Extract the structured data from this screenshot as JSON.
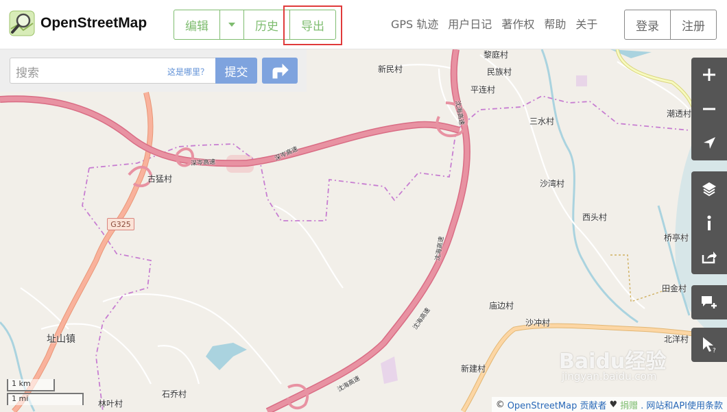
{
  "header": {
    "brand": "OpenStreetMap",
    "edit_group": {
      "edit": "编辑",
      "history": "历史",
      "export": "导出"
    },
    "secondary_nav": [
      "GPS 轨迹",
      "用户日记",
      "著作权",
      "帮助",
      "关于"
    ],
    "auth": {
      "login": "登录",
      "signup": "注册"
    }
  },
  "search": {
    "placeholder": "搜索",
    "where_am_i": "这是哪里？",
    "submit": "提交"
  },
  "map": {
    "places": {
      "liting": "黎庭村",
      "xinmin": "新民村",
      "minzu": "民族村",
      "pinglian": "平连村",
      "chaotou": "潮透村",
      "sanshui": "三水村",
      "shawan": "沙湾村",
      "gumeng": "古猛村",
      "xitou": "西头村",
      "qiaoting": "桥亭村",
      "tianjin": "田金村",
      "miaobian": "庙边村",
      "shachong": "沙冲村",
      "beiyang": "北洋村",
      "zhishan": "址山镇",
      "xinjian": "新建村",
      "linye": "林叶村",
      "shiqiao": "石乔村"
    },
    "road_shield": "G325",
    "road_names": {
      "shenling_1": "深岑高速",
      "shenling_2": "深岑高速",
      "shenhai_1": "沈海高速",
      "shenhai_2": "沈海高速",
      "shenhai_3": "沈海高速",
      "shenhai_4": "沈海高速"
    },
    "scale": {
      "km": "1 km",
      "mi": "1 mi"
    },
    "attribution": {
      "prefix": "©",
      "osm": "OpenStreetMap 贡献者",
      "heart": "♥",
      "donate": "捐赠",
      "terms": ". 网站和API使用条款"
    }
  },
  "watermark": {
    "title": "Baidu经验",
    "url": "jingyan.baidu.com"
  },
  "colors": {
    "brand_green": "#7ebc6f",
    "highlight_red": "#e03a3a",
    "search_blue": "#7ea3de",
    "map_bg": "#f2efe9",
    "motorway": "#e892a2",
    "trunk": "#f9b29c",
    "primary_orange": "#fcd6a4",
    "boundary": "#c77dd1",
    "water": "#aad3df",
    "control_grey": "#555555"
  },
  "icons": {
    "logo": "osm-logo-icon",
    "directions": "directions-icon",
    "zoom_in": "zoom-in-icon",
    "zoom_out": "zoom-out-icon",
    "locate": "locate-arrow-icon",
    "layers": "layers-icon",
    "info": "info-icon",
    "share": "share-icon",
    "add_note": "add-note-icon",
    "query": "query-cursor-icon"
  }
}
